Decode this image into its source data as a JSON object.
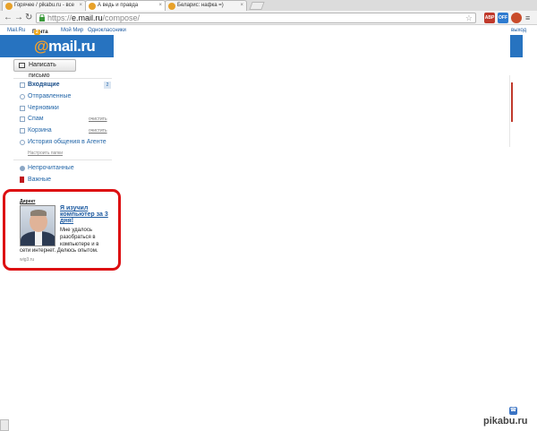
{
  "browser": {
    "tabs": [
      {
        "title": "Горячее / pikabu.ru - все"
      },
      {
        "title": "А ведь и правда"
      },
      {
        "title": "Беларис: нафка =)"
      }
    ],
    "url_prefix": "https://",
    "url_host": "e.mail.ru",
    "url_path": "/compose/",
    "extensions": [
      "ABP",
      "OFF"
    ]
  },
  "portal_menu": {
    "items": [
      "Mail.Ru",
      "Почта",
      "Мой Мир",
      "Одноклассники"
    ],
    "mail_badge": "2",
    "exit_label": "выход"
  },
  "header": {
    "logo_at": "@",
    "logo_text": "mail.ru"
  },
  "compose_button": {
    "label": "Написать письмо"
  },
  "folders": [
    {
      "label": "Входящие",
      "count": "2"
    },
    {
      "label": "Отправленные"
    },
    {
      "label": "Черновики"
    },
    {
      "label": "Спам",
      "action": "очистить"
    },
    {
      "label": "Корзина",
      "action": "очистить"
    },
    {
      "label": "История общения в Агенте"
    }
  ],
  "setup_folders": "Настроить папки",
  "filters": [
    {
      "label": "Непрочитанные"
    },
    {
      "label": "Важные"
    }
  ],
  "ad": {
    "label": "Директ",
    "title": "Я изучил компьютер за 3 дня!",
    "text": "Мне удалось разобраться в компьютере и в",
    "text2": "сети интернет. Делюсь опытом.",
    "domain": "wig3.ru"
  },
  "watermark": "pikabu.ru",
  "colors": {
    "brand_blue": "#2773c0",
    "logo_orange": "#f8a32a",
    "highlight_red": "#dd0f12"
  }
}
